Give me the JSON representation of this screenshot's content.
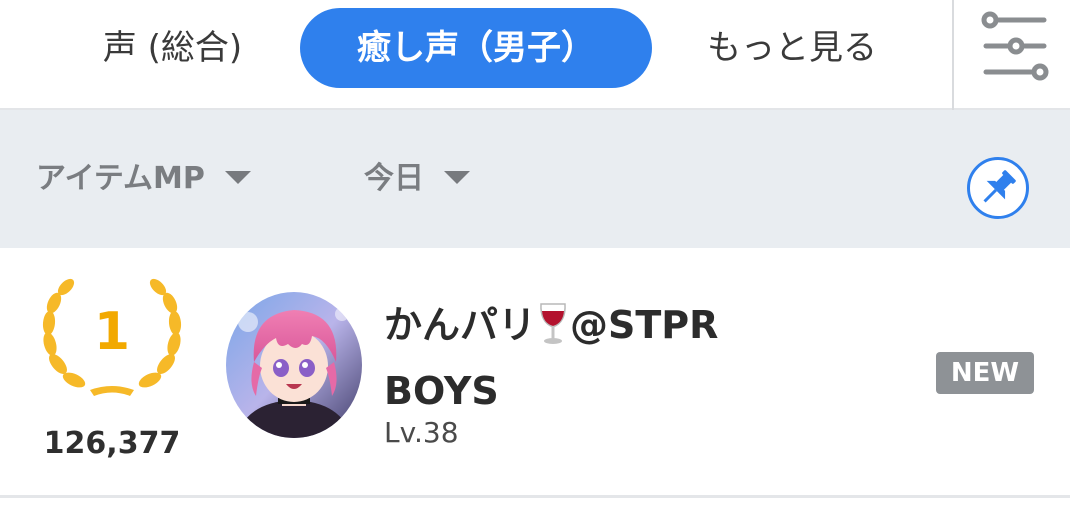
{
  "tabs": [
    {
      "label": "声 (総合)"
    },
    {
      "label": "癒し声（男子）"
    },
    {
      "label": "もっと見る"
    }
  ],
  "filters": {
    "item_label": "アイテムMP",
    "date_label": "今日"
  },
  "icons": {
    "filter": "sliders-icon",
    "pin": "pin-icon",
    "caret": "caret-down-icon",
    "laurel": "laurel-wreath-icon",
    "wine": "wine-glass-emoji"
  },
  "colors": {
    "accent": "#2f80ed",
    "rank_gold": "#f2a900",
    "badge_gray": "#8e9296",
    "filterbar_bg": "#e9edf1"
  },
  "ranking": [
    {
      "rank": "1",
      "score": "126,377",
      "name_part1": "かんパリ",
      "name_part2": "@STPR",
      "name_line2": "BOYS",
      "level": "Lv.38",
      "badge": "NEW"
    }
  ]
}
